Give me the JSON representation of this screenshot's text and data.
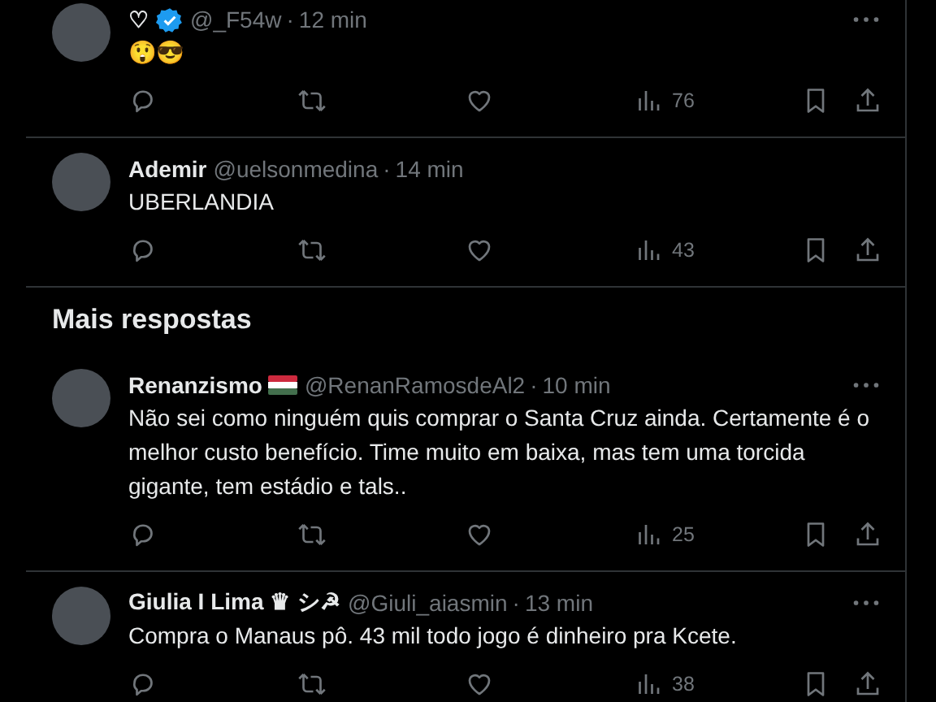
{
  "posts": [
    {
      "name": "♡",
      "verified": true,
      "flag": false,
      "handle": "@_F54w",
      "separator": "·",
      "time": "12 min",
      "text": "😲😎",
      "views": "76",
      "more": true
    },
    {
      "name": "Ademir",
      "verified": false,
      "flag": false,
      "handle": "@uelsonmedina",
      "separator": "·",
      "time": "14 min",
      "text": "UBERLANDIA",
      "views": "43",
      "more": false
    }
  ],
  "section_title": "Mais respostas",
  "replies": [
    {
      "name": "Renanzismo",
      "verified": false,
      "flag": true,
      "handle": "@RenanRamosdeAl2",
      "separator": "·",
      "time": "10 min",
      "text": "Não sei como ninguém quis comprar o Santa Cruz ainda. Certamente é o melhor custo benefício. Time muito em baixa, mas tem uma torcida gigante, tem estádio e tals..",
      "views": "25",
      "more": true
    },
    {
      "name": "Giulia I Lima ♛ シ☭",
      "verified": false,
      "flag": false,
      "handle": "@Giuli_aiasmin",
      "separator": "·",
      "time": "13 min",
      "text": "Compra o Manaus pô. 43 mil todo jogo é dinheiro pra Kcete.",
      "views": "38",
      "more": true
    }
  ]
}
